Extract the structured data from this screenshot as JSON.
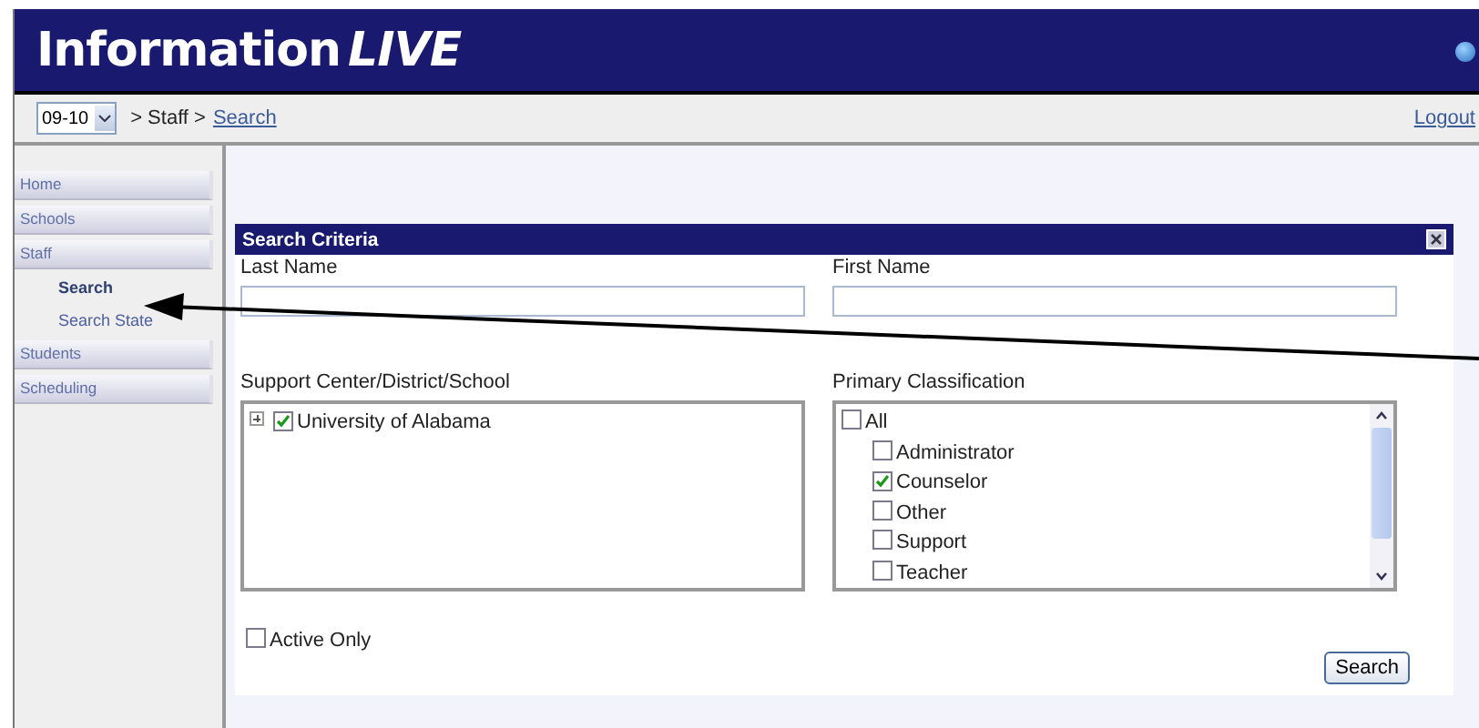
{
  "app": {
    "title": "Information",
    "title_suffix": "LIVE"
  },
  "breadcrumb": {
    "year": "09-10",
    "path": "> Staff >",
    "link": "Search",
    "logout": "Logout"
  },
  "sidebar": {
    "items": [
      {
        "label": "Home",
        "selected": false
      },
      {
        "label": "Schools",
        "selected": false
      },
      {
        "label": "Staff",
        "selected": false,
        "children": [
          {
            "label": "Search",
            "selected": true
          },
          {
            "label": "Search State",
            "selected": false
          }
        ]
      },
      {
        "label": "Students",
        "selected": false
      },
      {
        "label": "Scheduling",
        "selected": false
      }
    ]
  },
  "search_panel": {
    "title": "Search Criteria",
    "fields": [
      {
        "label": "Last Name"
      },
      {
        "label": "First Name"
      }
    ],
    "org_tree": {
      "label": "Support Center/District/School",
      "items": [
        {
          "label": "University of Alabama",
          "checked": true,
          "expanded": false
        }
      ]
    },
    "classification": {
      "label": "Primary Classification",
      "options": [
        {
          "label": "All",
          "checked": false,
          "children": [
            {
              "label": "Administrator",
              "checked": false
            },
            {
              "label": "Counselor",
              "checked": true
            },
            {
              "label": "Other",
              "checked": false
            },
            {
              "label": "Support",
              "checked": false
            },
            {
              "label": "Teacher",
              "checked": false
            }
          ]
        }
      ]
    },
    "active_only": {
      "label": "Active Only",
      "checked": false
    },
    "search_button": "Search"
  }
}
